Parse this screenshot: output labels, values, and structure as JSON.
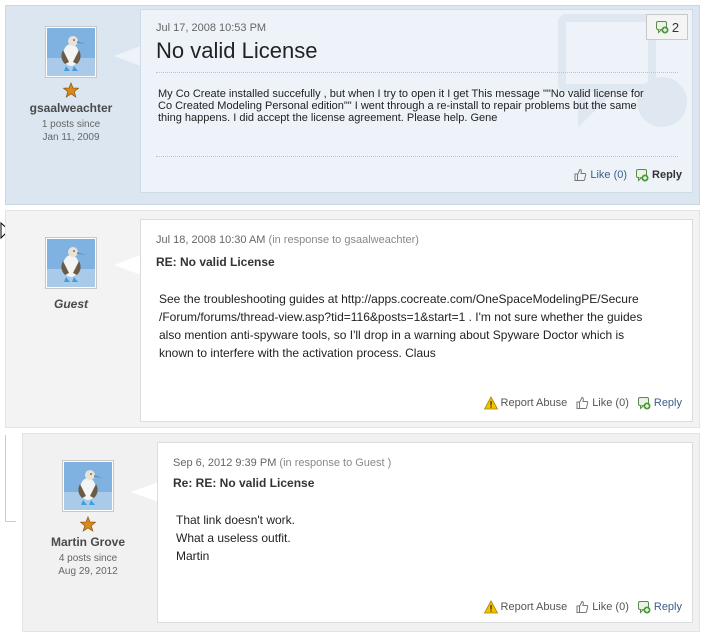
{
  "colors": {
    "highlight_bg": "#dbe6f1",
    "normal_bg": "#f3f3f3",
    "link": "#3b5e8a",
    "star": "#d88a1a",
    "reply_green": "#4a9a3a",
    "abuse_yellow": "#e0b000"
  },
  "icons": {
    "avatar": "blue-footed-booby-avatar",
    "rank": "bronze-star-icon",
    "like": "thumbs-up-icon",
    "reply": "reply-icon",
    "report": "warning-icon",
    "reply_count": "reply-count-icon"
  },
  "posts": [
    {
      "author": {
        "name": "gsaalweachter",
        "stats_line1": "1 posts since",
        "stats_line2": "Jan 11, 2009"
      },
      "timestamp": "Jul 17, 2008 10:53 PM",
      "in_response_to": "",
      "title": "No valid License",
      "body": "My Co Create installed succefully , but when I try to open it I get This message \"\"No valid license for Co Created Modeling Personal edition\"\" I went through a re-install to repair problems but the same thing happens. I did accept the license agreement. Please help. Gene",
      "reply_count": "2",
      "like_label": "Like (0)",
      "reply_label": "Reply",
      "report_label": ""
    },
    {
      "author": {
        "name": "Guest",
        "stats_line1": "",
        "stats_line2": ""
      },
      "timestamp": "Jul 18, 2008 10:30 AM",
      "in_response_to": "(in response to gsaalweachter)",
      "title": "RE: No valid License",
      "body_lines": [
        "See the troubleshooting guides at http://apps.cocreate.com/OneSpaceModelingPE/Secure",
        "/Forum/forums/thread-view.asp?tid=116&posts=1&start=1 . I'm not sure whether the guides",
        "also mention anti-spyware tools, so I'll drop in a warning about Spyware Doctor which is",
        "known to interfere with the activation process. Claus"
      ],
      "like_label": "Like (0)",
      "reply_label": "Reply",
      "report_label": "Report Abuse"
    },
    {
      "author": {
        "name": "Martin Grove",
        "stats_line1": "4 posts since",
        "stats_line2": "Aug 29, 2012"
      },
      "timestamp": "Sep 6, 2012 9:39 PM",
      "in_response_to": "(in response to Guest )",
      "title": "Re: RE: No valid License",
      "body_lines": [
        "That link doesn't work.",
        "What a useless outfit.",
        "Martin"
      ],
      "like_label": "Like (0)",
      "reply_label": "Reply",
      "report_label": "Report Abuse"
    }
  ]
}
